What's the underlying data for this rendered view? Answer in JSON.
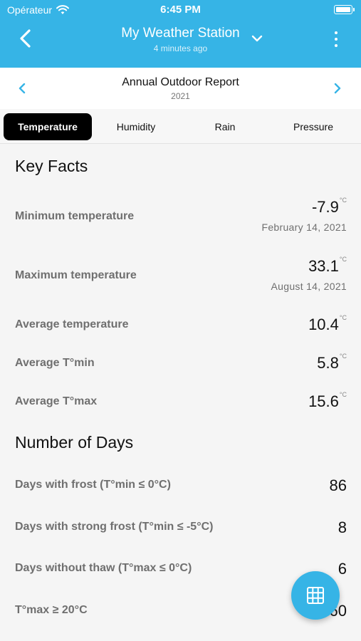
{
  "status_bar": {
    "carrier": "Opérateur",
    "time": "6:45 PM",
    "wifi_icon": "wifi-icon",
    "battery_icon": "battery-icon"
  },
  "nav": {
    "title": "My Weather Station",
    "subtitle": "4 minutes ago",
    "back_icon": "chevron-left-icon",
    "dropdown_icon": "chevron-down-icon",
    "menu_icon": "more-vertical-icon"
  },
  "report": {
    "title": "Annual Outdoor Report",
    "year": "2021",
    "prev_icon": "chevron-left-icon",
    "next_icon": "chevron-right-icon"
  },
  "tabs": [
    {
      "label": "Temperature",
      "active": true
    },
    {
      "label": "Humidity",
      "active": false
    },
    {
      "label": "Rain",
      "active": false
    },
    {
      "label": "Pressure",
      "active": false
    }
  ],
  "key_facts": {
    "title": "Key Facts",
    "unit": "°C",
    "rows": [
      {
        "label": "Minimum temperature",
        "value": "-7.9",
        "date": "February 14, 2021"
      },
      {
        "label": "Maximum temperature",
        "value": "33.1",
        "date": "August 14, 2021"
      },
      {
        "label": "Average temperature",
        "value": "10.4"
      },
      {
        "label": "Average T°min",
        "value": "5.8"
      },
      {
        "label": "Average T°max",
        "value": "15.6"
      }
    ]
  },
  "days": {
    "title": "Number of Days",
    "rows": [
      {
        "label": "Days with frost (T°min ≤ 0°C)",
        "value": "86"
      },
      {
        "label": "Days with strong frost (T°min ≤ -5°C)",
        "value": "8"
      },
      {
        "label": "Days without thaw (T°max ≤ 0°C)",
        "value": "6"
      },
      {
        "label": "T°max ≥ 20°C",
        "value": "60"
      }
    ]
  },
  "fab": {
    "icon": "grid-table-icon"
  },
  "colors": {
    "accent": "#36b4e6",
    "tab_active": "#000000",
    "label_gray": "#6f6f6f"
  }
}
